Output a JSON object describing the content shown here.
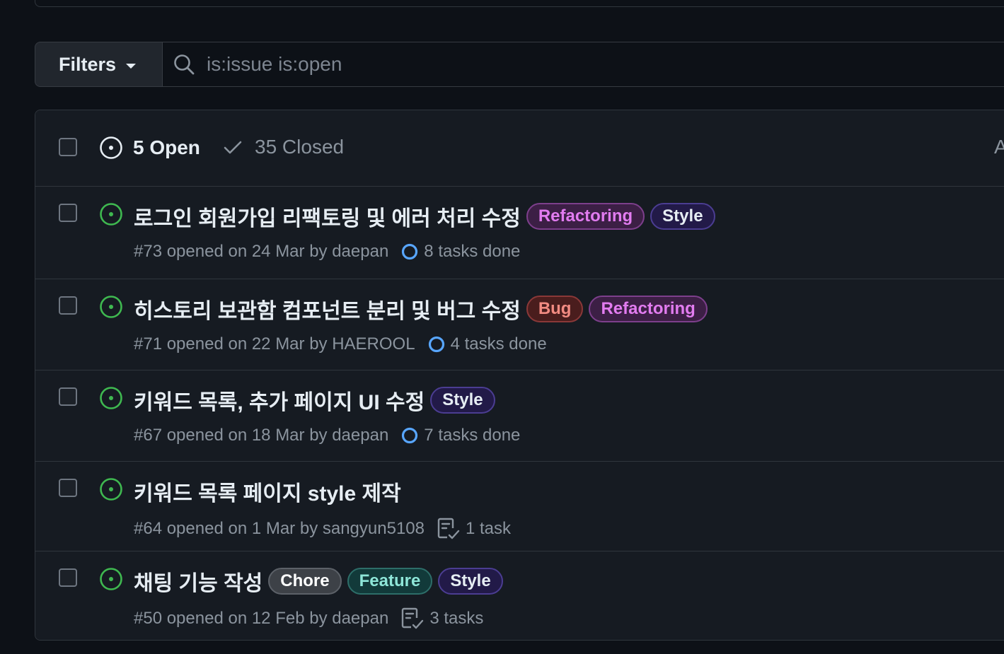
{
  "filter_bar": {
    "filters_label": "Filters",
    "search_value": "is:issue is:open"
  },
  "issues_header": {
    "open_label": "5 Open",
    "closed_label": "35 Closed",
    "author_label": "A"
  },
  "issues": [
    {
      "title": "로그인 회원가입 리팩토링 및 에러 처리 수정",
      "labels": [
        {
          "name": "Refactoring",
          "text": "#e27cf0",
          "bg": "#3c1f45",
          "border": "#7d3f8c"
        },
        {
          "name": "Style",
          "text": "#e6edf3",
          "bg": "#221a48",
          "border": "#4b3d92"
        }
      ],
      "meta": "#73 opened on 24 Mar by daepan",
      "task_icon": "progress-ring-icon",
      "tasks": "8 tasks done"
    },
    {
      "title": "히스토리 보관함 컴포넌트 분리 및 버그 수정",
      "labels": [
        {
          "name": "Bug",
          "text": "#f28b82",
          "bg": "#4a1d1d",
          "border": "#8a3838"
        },
        {
          "name": "Refactoring",
          "text": "#e27cf0",
          "bg": "#3c1f45",
          "border": "#7d3f8c"
        }
      ],
      "meta": "#71 opened on 22 Mar by HAEROOL",
      "task_icon": "progress-ring-icon",
      "tasks": "4 tasks done"
    },
    {
      "title": "키워드 목록, 추가 페이지 UI 수정",
      "labels": [
        {
          "name": "Style",
          "text": "#e6edf3",
          "bg": "#221a48",
          "border": "#4b3d92"
        }
      ],
      "meta": "#67 opened on 18 Mar by daepan",
      "task_icon": "progress-ring-icon",
      "tasks": "7 tasks done"
    },
    {
      "title": "키워드 목록 페이지 style 제작",
      "labels": [],
      "meta": "#64 opened on 1 Mar by sangyun5108",
      "task_icon": "checklist-icon",
      "tasks": "1 task"
    },
    {
      "title": "채팅 기능 작성",
      "labels": [
        {
          "name": "Chore",
          "text": "#ffffff",
          "bg": "#3d4147",
          "border": "#5c6168"
        },
        {
          "name": "Feature",
          "text": "#8ee6d8",
          "bg": "#123a3a",
          "border": "#2d6e69"
        },
        {
          "name": "Style",
          "text": "#e6edf3",
          "bg": "#221a48",
          "border": "#4b3d92"
        }
      ],
      "meta": "#50 opened on 12 Feb by daepan",
      "task_icon": "checklist-icon",
      "tasks": "3 tasks"
    }
  ],
  "colors": {
    "open_green": "#3fb950",
    "progress_blue": "#58a6ff",
    "muted": "#8b949e"
  }
}
